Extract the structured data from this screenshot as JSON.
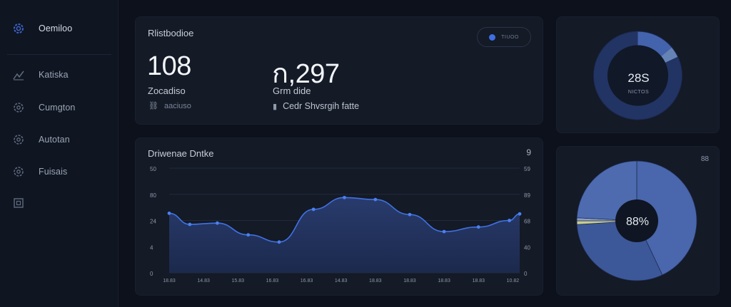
{
  "sidebar": {
    "items": [
      {
        "label": "Oemiloo",
        "icon": "gear-icon",
        "active": true
      },
      {
        "label": "Katiska",
        "icon": "chart-icon",
        "active": false
      },
      {
        "label": "Cumgton",
        "icon": "cog-icon",
        "active": false
      },
      {
        "label": "Autotan",
        "icon": "cog-icon",
        "active": false
      },
      {
        "label": "Fuisais",
        "icon": "cog-icon",
        "active": false
      },
      {
        "label": "",
        "icon": "grid-icon",
        "active": false
      }
    ]
  },
  "stats": {
    "title": "Rlistbodioe",
    "pill_label": "TIUOO",
    "metrics": [
      {
        "value": "108",
        "label": "Zocadiso",
        "sub_icon": "link-icon",
        "sub_text": "aaciuso"
      },
      {
        "value": "ก,297",
        "label": "Grm dide",
        "sub_icon": "doc-icon",
        "sub_text": "Cedr Shvsrgih fatte"
      }
    ]
  },
  "chart": {
    "title": "Driwenae Dntke",
    "info_label": "9",
    "chart_data": {
      "type": "area",
      "title": "Driwenae Dntke",
      "x": [
        "18.83",
        "14.83",
        "15.83",
        "16.83",
        "16.83",
        "14.83",
        "18.83",
        "18.83",
        "18.83",
        "18.83",
        "10.82"
      ],
      "y_left_ticks": [
        "0",
        "4",
        "24",
        "80",
        "50"
      ],
      "y_right_ticks": [
        "0",
        "40",
        "68",
        "89",
        "59"
      ],
      "ylim": [
        0,
        80
      ],
      "points": [
        {
          "x": 0,
          "y": 45.5
        },
        {
          "x": 0.6,
          "y": 37
        },
        {
          "x": 1.4,
          "y": 38
        },
        {
          "x": 2.3,
          "y": 29
        },
        {
          "x": 3.2,
          "y": 23.5
        },
        {
          "x": 4.2,
          "y": 48.5
        },
        {
          "x": 5.1,
          "y": 57.5
        },
        {
          "x": 6.0,
          "y": 56
        },
        {
          "x": 7.0,
          "y": 44.5
        },
        {
          "x": 8.0,
          "y": 31.5
        },
        {
          "x": 9.0,
          "y": 35
        },
        {
          "x": 9.9,
          "y": 40
        },
        {
          "x": 10.2,
          "y": 45
        }
      ],
      "line_color": "#3f72e6",
      "fill_color": "#2a3d70"
    }
  },
  "ring": {
    "value": "28S",
    "label": "NICTOS",
    "segments": [
      {
        "value": 14,
        "color": "#4463ad"
      },
      {
        "value": 4,
        "color": "#6683b5"
      },
      {
        "value": 82,
        "color": "#223463"
      }
    ]
  },
  "pie": {
    "value": "88%",
    "corner": "88",
    "segments": [
      {
        "value": 43,
        "color": "#4a66ac"
      },
      {
        "value": 31,
        "color": "#3c5899"
      },
      {
        "value": 1,
        "color": "#c8cc8e"
      },
      {
        "value": 0.8,
        "color": "#8aa0c8"
      },
      {
        "value": 24.2,
        "color": "#4e6bb0"
      }
    ]
  },
  "colors": {
    "background": "#0c111b",
    "card": "#141a26",
    "accent": "#3f6fe0"
  }
}
